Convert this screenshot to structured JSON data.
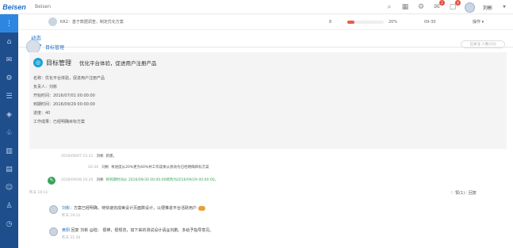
{
  "app": {
    "brand": "Beisen",
    "brand_sub": "Beisen"
  },
  "topbar": {
    "user": "刘彬",
    "badge1": "2",
    "badge2": "8"
  },
  "task": {
    "title": "KR2：基于数据调查，制定优化方案",
    "num": "8",
    "progress": 0.2,
    "progress_text": "20%",
    "date": "09-30",
    "action": "操作 ▾"
  },
  "tabs": [
    "动态"
  ],
  "feed": {
    "header_title": "目标管理",
    "follow": "已关注 人数(10)",
    "card_type": "目标管理",
    "card_name": "优化平台体验，促进用户注册产品",
    "fields": [
      "名称：优化平台体验，促进用户注册产品",
      "负责人：刘彬",
      "开始时间：2016/07/01 00:00:00",
      "到期时间：2016/09/29 00:00:00",
      "进度：40",
      "工作成果：已经明确目标方案"
    ]
  },
  "log": [
    {
      "time": "2016/09/07 15:11",
      "user": "刘彬",
      "text": "新建。"
    },
    {
      "time": "20:34",
      "user": "刘彬",
      "text": "将进度从20%更为40%并工作成果从损效为已经明确目标方案"
    },
    {
      "time": "2016/09/08 10:20",
      "user": "刘彬",
      "text": "将到期时间从 2016/09/30 00:00:00修改为2016/09/29 00:00:00。"
    }
  ],
  "feed_meta": {
    "time": "昨天 19:11",
    "like": "♡ 赞(1)",
    "reply": "回复"
  },
  "comments": [
    {
      "user": "刘彬",
      "text": "方案已经明确，待快速完成美设计页面数设计，以便推进平台活跃用户",
      "time": "昨天 19:11"
    },
    {
      "user": "黄阳",
      "text": "回复 刘彬 @陆： 很棒，很规范，如下来的测试设计请@刘鹏。多给予指导意见。",
      "time": "昨天 21:30"
    }
  ]
}
